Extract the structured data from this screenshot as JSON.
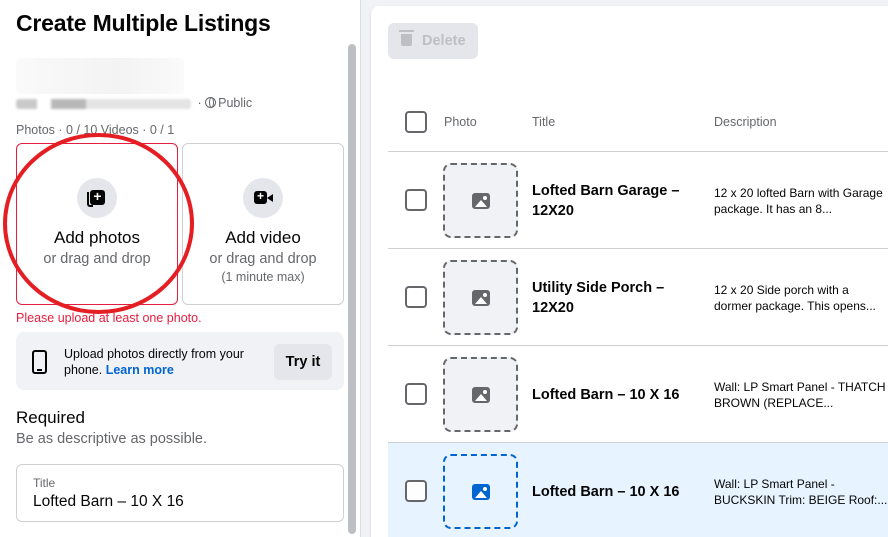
{
  "left_panel": {
    "title": "Create Multiple Listings",
    "seller_privacy": "Public",
    "counts": "Photos · 0 / 10 Videos · 0 / 1",
    "add_photos": {
      "title": "Add photos",
      "subtitle": "or drag and drop"
    },
    "add_video": {
      "title": "Add video",
      "subtitle": "or drag and drop",
      "note": "(1 minute max)"
    },
    "error": "Please upload at least one photo.",
    "phone_upload": {
      "text": "Upload photos directly from your phone.",
      "link": "Learn more",
      "button": "Try it"
    },
    "required": {
      "heading": "Required",
      "subtitle": "Be as descriptive as possible."
    },
    "title_field": {
      "label": "Title",
      "value": "Lofted Barn – 10 X 16"
    }
  },
  "right_panel": {
    "delete_label": "Delete",
    "columns": {
      "photo": "Photo",
      "title": "Title",
      "description": "Description"
    },
    "rows": [
      {
        "title": "Lofted Barn Garage – 12X20",
        "description": "12 x 20 lofted Barn with Garage package. It has an 8...",
        "selected": false
      },
      {
        "title": "Utility Side Porch – 12X20",
        "description": "12 x 20 Side porch with a dormer package. This opens...",
        "selected": false
      },
      {
        "title": "Lofted Barn – 10 X 16",
        "description": "Wall: LP Smart Panel - THATCH BROWN (REPLACE...",
        "selected": false
      },
      {
        "title": "Lofted Barn – 10 X 16",
        "description": "Wall: LP Smart Panel - BUCKSKIN Trim: BEIGE Roof:...",
        "selected": true
      }
    ]
  },
  "colors": {
    "accent": "#0064d1",
    "error": "#e41e3f",
    "annotation_circle": "#e41e22",
    "selected_row": "#e7f3ff"
  },
  "icons": [
    "add-photo-icon",
    "add-video-icon",
    "globe-icon",
    "phone-icon",
    "trash-icon",
    "image-placeholder-icon"
  ]
}
